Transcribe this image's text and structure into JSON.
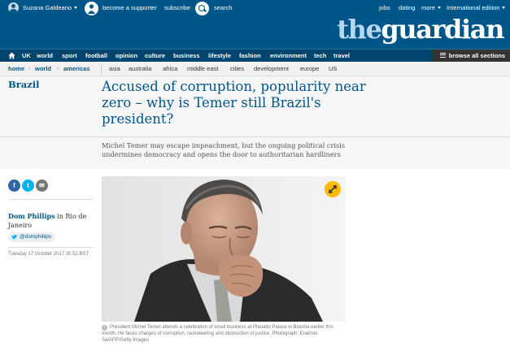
{
  "topbar": {
    "user_name": "Suzana Galdeano",
    "supporter_label": "become a supporter",
    "subscribe_label": "subscribe",
    "search_label": "search",
    "jobs_label": "jobs",
    "dating_label": "dating",
    "more_label": "more",
    "edition_label": "International edition"
  },
  "logo": {
    "prefix": "the",
    "word": "guardian"
  },
  "nav": {
    "items": [
      "UK",
      "world",
      "sport",
      "football",
      "opinion",
      "culture",
      "business",
      "lifestyle",
      "fashion",
      "environment",
      "tech",
      "travel"
    ],
    "browse_label": "browse all sections"
  },
  "breadcrumb": {
    "home": "home",
    "world": "world",
    "current": "americas",
    "subsections": [
      "asia",
      "australia",
      "africa",
      "middle east",
      "cities",
      "development",
      "europe",
      "US"
    ]
  },
  "article": {
    "section": "Brazil",
    "headline": "Accused of corruption, popularity near zero – why is Temer still Brazil's president?",
    "standfirst": "Michel Temer may escape impeachment, but the ongoing political crisis undermines democracy and opens the door to authoritarian hardliners",
    "author": "Dom Phillips",
    "location": "in Rio de Janeiro",
    "twitter": "@domphillips",
    "dateline": "Tuesday 17 October 2017 20.52 BST",
    "caption": "President Michel Temer attends a celebration of small business at Planalto Palace in Brasilia earlier this month. He faces charges of corruption, racketeering and obstruction of justice. Photograph: Evaristo Sa/AFP/Getty Images"
  },
  "share": {
    "facebook": "f",
    "twitter": "t",
    "email": "✉"
  },
  "colors": {
    "brand_blue": "#005689",
    "nav_blue": "#00456e",
    "expand_yellow": "#ffbb00"
  },
  "icons": [
    "user-avatar-icon",
    "supporter-icon",
    "search-icon",
    "home-icon",
    "menu-icon",
    "facebook-icon",
    "twitter-icon",
    "email-icon",
    "expand-icon",
    "info-icon"
  ]
}
